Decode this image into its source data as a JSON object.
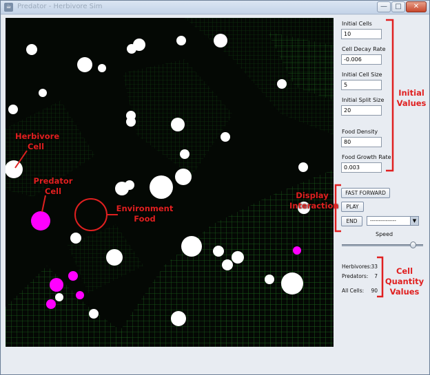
{
  "window": {
    "title": "Predator - Herbivore Sim",
    "minimize": "—",
    "maximize": "□",
    "close": "✕"
  },
  "panel": {
    "fields": [
      {
        "label": "Initial Cells",
        "value": "10"
      },
      {
        "label": "Cell Decay Rate",
        "value": "-0.006"
      },
      {
        "label": "Initial Cell Size",
        "value": "5"
      },
      {
        "label": "Initial Split Size",
        "value": "20"
      },
      {
        "label": "Food Density",
        "value": "80"
      },
      {
        "label": "Food Growth Rate",
        "value": "0.003"
      }
    ],
    "buttons": {
      "fast_forward": "FAST FORWARD",
      "play": "PLAY",
      "end": "END"
    },
    "combo_value": "---------------",
    "speed_label": "Speed",
    "speed_level": 0.88,
    "counts": [
      {
        "label": "Herbivores:",
        "value": "33"
      },
      {
        "label": "Predators:",
        "value": "7"
      },
      {
        "label": "All Cells:",
        "value": "90"
      }
    ]
  },
  "annotations": {
    "herbivore": "Herbivore\nCell",
    "predator": "Predator\nCell",
    "environment": "Environment\nFood",
    "initial_values": "Initial\nValues",
    "display": "Display\nInteraction",
    "cell_quantity": "Cell\nQuantity\nValues"
  },
  "colors": {
    "herbivore": "#ffffff",
    "predator": "#ff00ff",
    "food": "#2fae2f",
    "annotation": "#e02020"
  }
}
